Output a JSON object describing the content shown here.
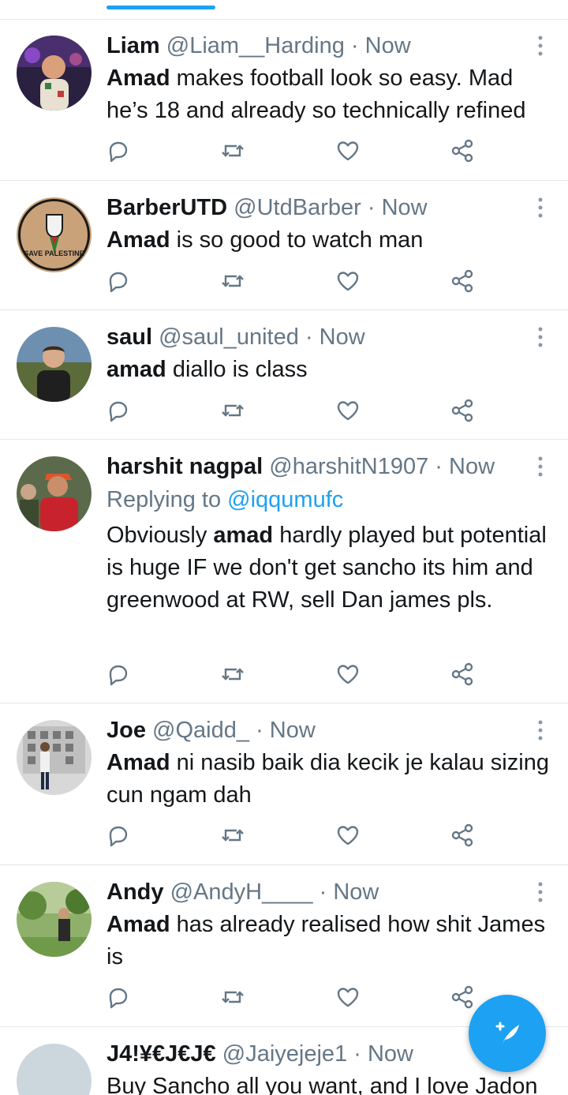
{
  "tweets": [
    {
      "name": "Liam",
      "handle": "@Liam__Harding",
      "time": "Now",
      "body_bold": "Amad",
      "body_rest": " makes football look so easy. Mad he’s 18 and already so technically refined"
    },
    {
      "name": "BarberUTD",
      "handle": "@UtdBarber",
      "time": "Now",
      "body_bold": "Amad",
      "body_rest": " is so good to watch man",
      "avatar_text": "SAVE PALESTINE"
    },
    {
      "name": "saul",
      "handle": "@saul_united",
      "time": "Now",
      "body_bold": "amad",
      "body_rest": " diallo is class"
    },
    {
      "name": "harshit nagpal",
      "handle": "@harshitN1907",
      "time": "Now",
      "reply_prefix": "Replying to",
      "reply_to": "@iqqumufc",
      "body_pre": "Obviously ",
      "body_bold": "amad",
      "body_rest": " hardly played but potential is huge IF we don't get sancho its him and greenwood at RW, sell Dan james pls."
    },
    {
      "name": "Joe",
      "handle": "@Qaidd_",
      "time": "Now",
      "body_bold": "Amad",
      "body_rest": " ni nasib baik dia kecik je kalau sizing cun ngam dah"
    },
    {
      "name": "Andy",
      "handle": "@AndyH____",
      "time": "Now",
      "body_bold": "Amad",
      "body_rest": " has already realised how shit James is"
    },
    {
      "name": "J4!¥€J€J€",
      "handle": "@Jaiyejeje1",
      "time": "Now",
      "body_rest": "Buy Sancho all you want, and I love Jadon"
    }
  ],
  "separator": "·",
  "icons": {
    "reply": "reply-icon",
    "retweet": "retweet-icon",
    "like": "heart-icon",
    "share": "share-icon",
    "more": "more-vertical-icon",
    "compose": "compose-tweet-icon"
  },
  "colors": {
    "accent": "#1da1f2",
    "secondary_text": "#657786",
    "primary_text": "#14171a",
    "divider": "#e1e8ed"
  }
}
